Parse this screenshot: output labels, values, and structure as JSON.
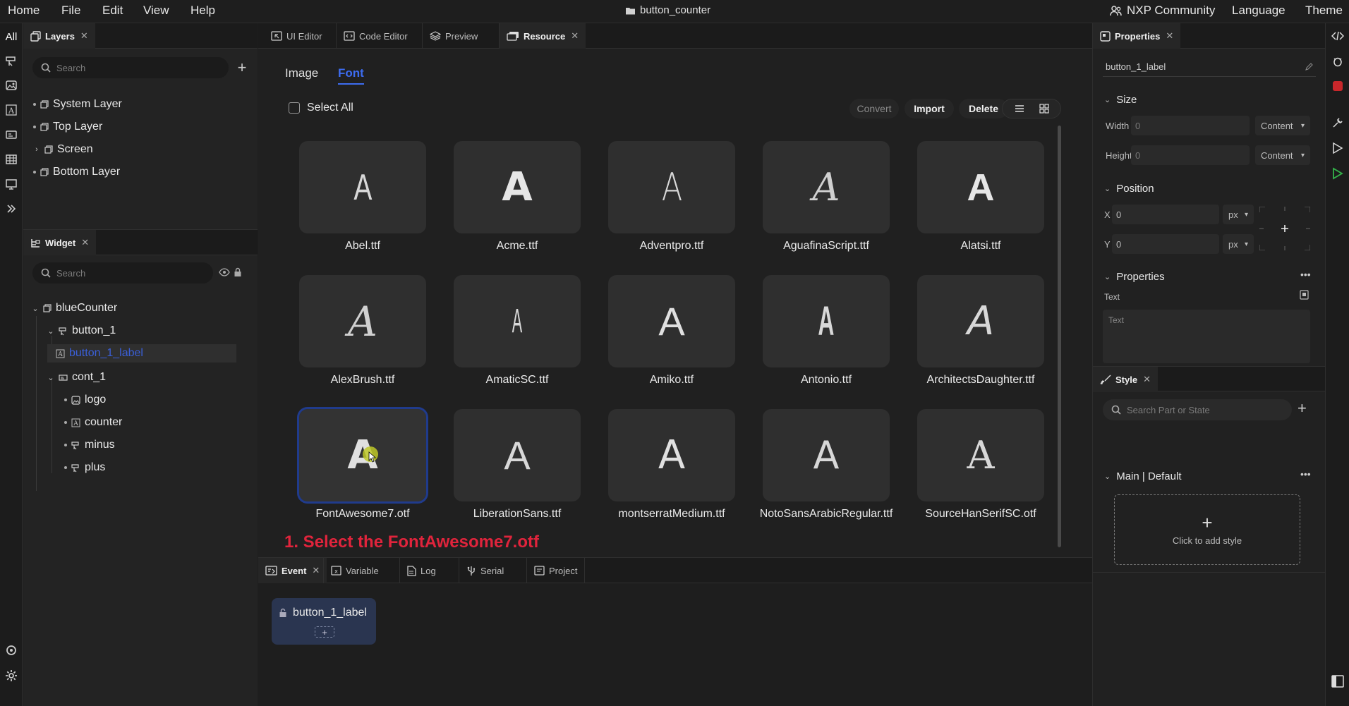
{
  "menu": {
    "home": "Home",
    "file": "File",
    "edit": "Edit",
    "view": "View",
    "help": "Help",
    "title": "button_counter",
    "community": "NXP Community",
    "language": "Language",
    "theme": "Theme"
  },
  "leftrail": {
    "all": "All"
  },
  "layers": {
    "tab_label": "Layers",
    "search_placeholder": "Search",
    "items": [
      "System Layer",
      "Top Layer",
      "Screen",
      "Bottom Layer"
    ]
  },
  "widget": {
    "tab_label": "Widget",
    "search_placeholder": "Search",
    "tree": {
      "root": "blueCounter",
      "button": "button_1",
      "button_label": "button_1_label",
      "cont": "cont_1",
      "logo": "logo",
      "counter": "counter",
      "minus": "minus",
      "plus": "plus"
    }
  },
  "center_tabs": [
    "UI Editor",
    "Code Editor",
    "Preview",
    "Resource"
  ],
  "resource": {
    "subtabs": {
      "image": "Image",
      "font": "Font"
    },
    "select_all": "Select All",
    "buttons": {
      "convert": "Convert",
      "import": "Import",
      "delete": "Delete"
    },
    "fonts": [
      {
        "name": "Abel.ttf",
        "glyph": "A"
      },
      {
        "name": "Acme.ttf",
        "glyph": "A"
      },
      {
        "name": "Adventpro.ttf",
        "glyph": "A"
      },
      {
        "name": "AguafinaScript.ttf",
        "glyph": "A"
      },
      {
        "name": "Alatsi.ttf",
        "glyph": "A"
      },
      {
        "name": "AlexBrush.ttf",
        "glyph": "A"
      },
      {
        "name": "AmaticSC.ttf",
        "glyph": "A"
      },
      {
        "name": "Amiko.ttf",
        "glyph": "A"
      },
      {
        "name": "Antonio.ttf",
        "glyph": "A"
      },
      {
        "name": "ArchitectsDaughter.ttf",
        "glyph": "A"
      },
      {
        "name": "FontAwesome7.otf",
        "glyph": "A"
      },
      {
        "name": "LiberationSans.ttf",
        "glyph": "A"
      },
      {
        "name": "montserratMedium.ttf",
        "glyph": "A"
      },
      {
        "name": "NotoSansArabicRegular.ttf",
        "glyph": "A"
      },
      {
        "name": "SourceHanSerifSC.otf",
        "glyph": "A"
      }
    ],
    "annotation": "1. Select the FontAwesome7.otf"
  },
  "bottom_tabs": [
    "Event",
    "Variable",
    "Log",
    "Serial",
    "Project"
  ],
  "event_card": {
    "label": "button_1_label",
    "add": "+"
  },
  "properties": {
    "tab_label": "Properties",
    "name": "button_1_label",
    "size_title": "Size",
    "width_label": "Width",
    "width_value": "0",
    "width_mode": "Content",
    "height_label": "Height",
    "height_value": "0",
    "height_mode": "Content",
    "position_title": "Position",
    "x_label": "X",
    "x_value": "0",
    "x_unit": "px",
    "y_label": "Y",
    "y_value": "0",
    "y_unit": "px",
    "props_title": "Properties",
    "text_label": "Text",
    "text_placeholder": "Text"
  },
  "style": {
    "tab_label": "Style",
    "search_placeholder": "Search Part or State",
    "main_title": "Main | Default",
    "add_style": "Click to add style"
  },
  "colors": {
    "accent": "#3d6cf0",
    "annotation": "#e0243c",
    "selected_text": "#3a5fd8"
  }
}
